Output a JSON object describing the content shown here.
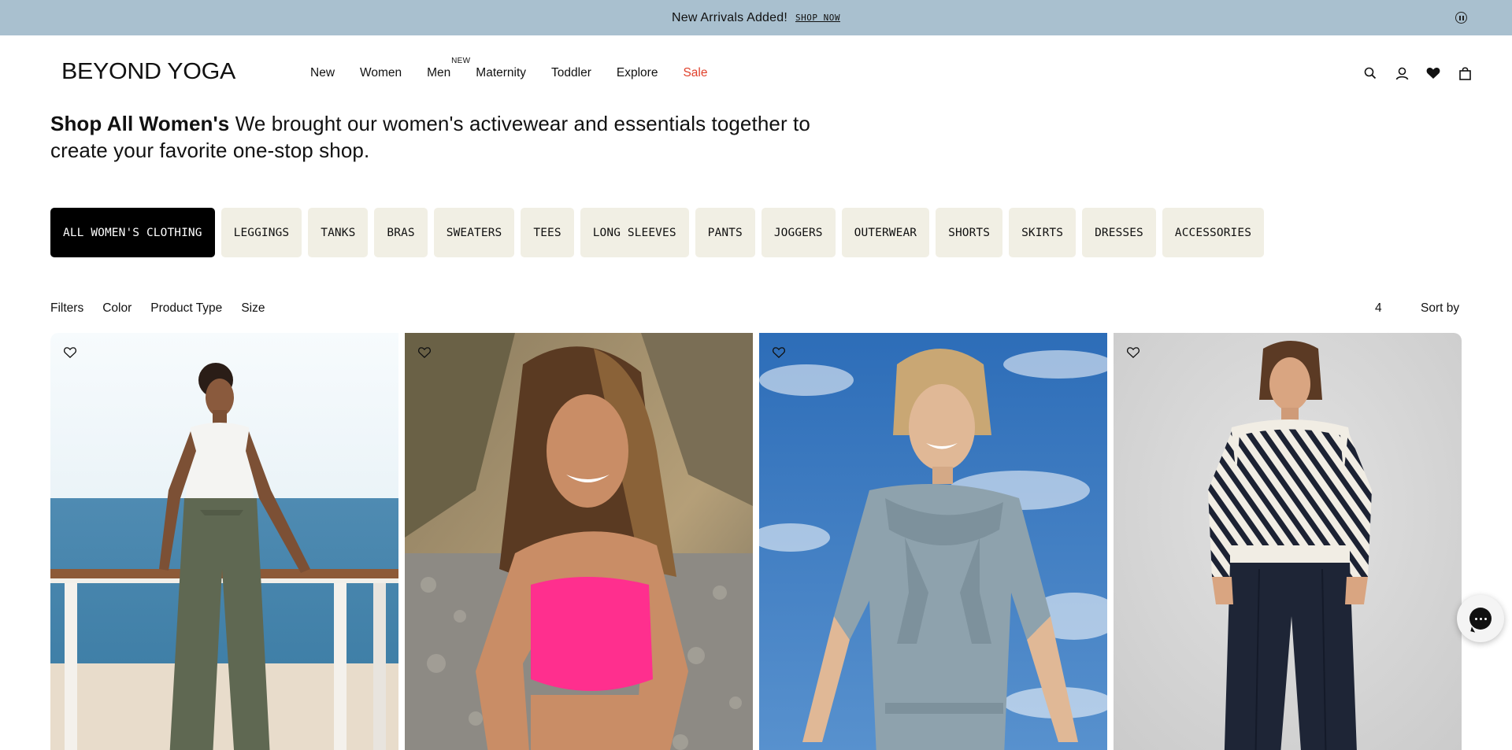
{
  "announcement": {
    "message": "New Arrivals Added!",
    "link": "SHOP NOW",
    "pause_icon": "pause-circle-icon"
  },
  "header": {
    "logo": "BEYOND YOGA",
    "nav": [
      {
        "label": "New"
      },
      {
        "label": "Women"
      },
      {
        "label": "Men",
        "badge": "NEW"
      },
      {
        "label": "Maternity"
      },
      {
        "label": "Toddler"
      },
      {
        "label": "Explore"
      },
      {
        "label": "Sale",
        "color": "#e0402b"
      }
    ],
    "icons": [
      "search-icon",
      "account-icon",
      "wishlist-heart-icon",
      "shopping-bag-icon"
    ]
  },
  "intro": {
    "title": "Shop All Women's",
    "text": "We brought our women's activewear and essentials together to create your favorite one-stop shop."
  },
  "categories": [
    {
      "label": "ALL WOMEN'S CLOTHING",
      "active": true
    },
    {
      "label": "LEGGINGS"
    },
    {
      "label": "TANKS"
    },
    {
      "label": "BRAS"
    },
    {
      "label": "SWEATERS"
    },
    {
      "label": "TEES"
    },
    {
      "label": "LONG SLEEVES"
    },
    {
      "label": "PANTS"
    },
    {
      "label": "JOGGERS"
    },
    {
      "label": "OUTERWEAR"
    },
    {
      "label": "SHORTS"
    },
    {
      "label": "SKIRTS"
    },
    {
      "label": "DRESSES"
    },
    {
      "label": "ACCESSORIES"
    }
  ],
  "filters": {
    "items": [
      "Filters",
      "Color",
      "Product Type",
      "Size"
    ],
    "grid_columns": "4",
    "sort_label": "Sort by"
  },
  "products": [
    {
      "scene": "woman in white tank and olive wide-leg pants by the sea",
      "wishlist_icon": "heart-outline-icon"
    },
    {
      "scene": "smiling woman in pink sports bra on rocky beach",
      "wishlist_icon": "heart-outline-icon"
    },
    {
      "scene": "woman in grey-blue hoodie set against blue sky",
      "wishlist_icon": "heart-outline-icon"
    },
    {
      "scene": "woman in striped sweater and navy pants on grey studio",
      "wishlist_icon": "heart-outline-icon"
    }
  ],
  "colors": {
    "announcement_bg": "#a9c0cf",
    "chip_bg": "#f1efe4",
    "chip_active_bg": "#000000",
    "sale": "#e0402b"
  },
  "chat_icon": "chat-bubble-icon"
}
